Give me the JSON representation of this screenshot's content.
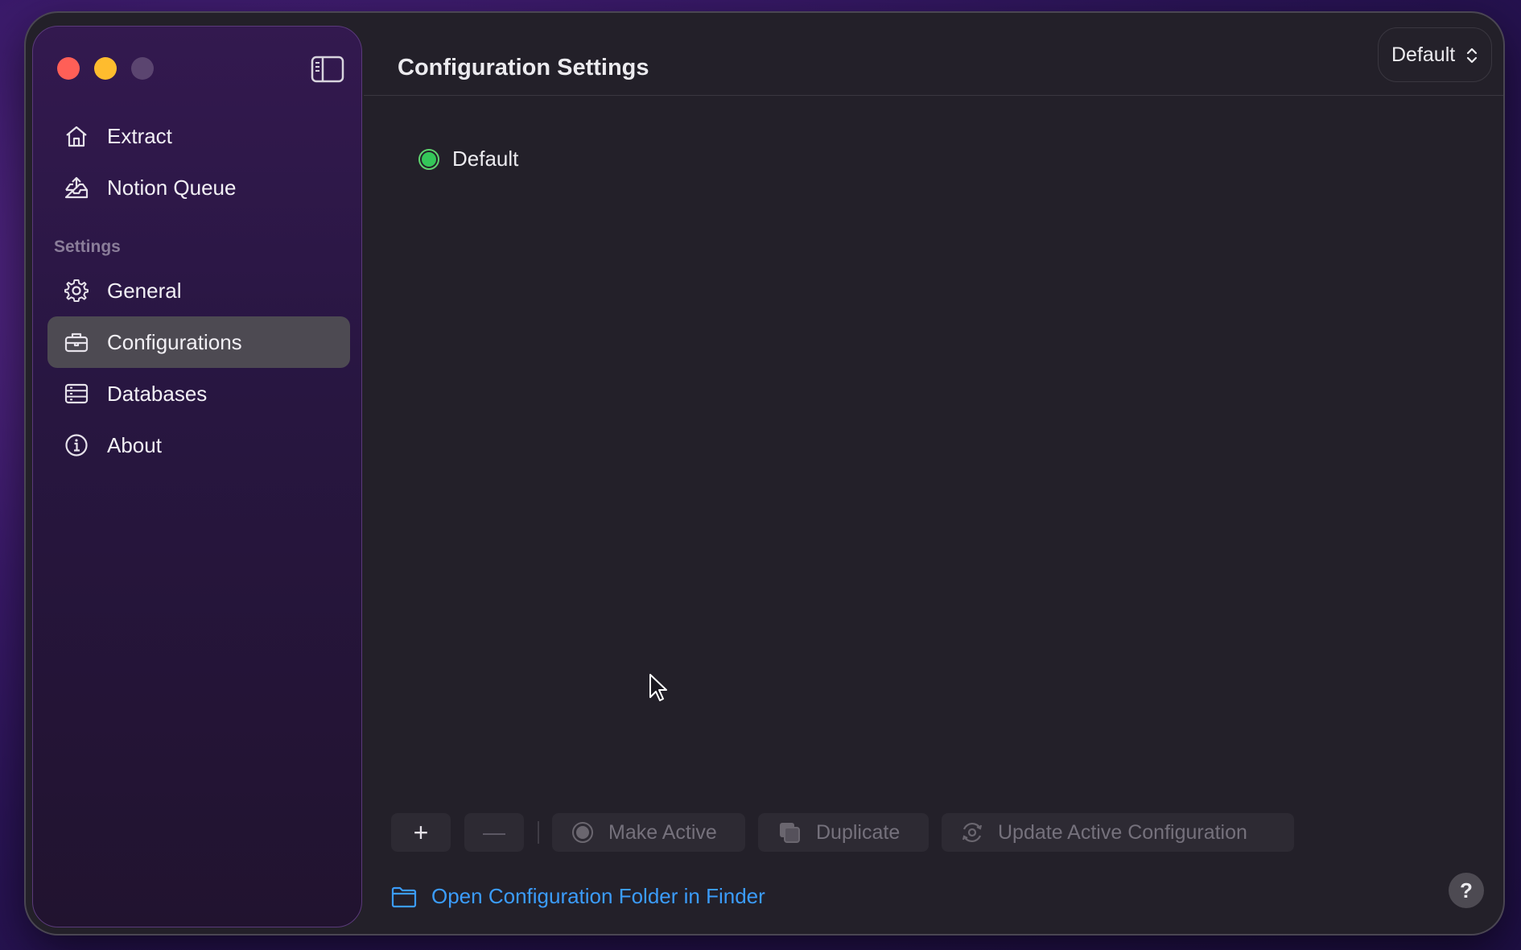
{
  "sidebar": {
    "nav_items": [
      {
        "label": "Extract",
        "icon": "house-icon"
      },
      {
        "label": "Notion Queue",
        "icon": "tray-upload-icon"
      }
    ],
    "section_label": "Settings",
    "settings_items": [
      {
        "label": "General",
        "icon": "gear-icon"
      },
      {
        "label": "Configurations",
        "icon": "briefcase-icon",
        "active": true
      },
      {
        "label": "Databases",
        "icon": "database-icon"
      },
      {
        "label": "About",
        "icon": "info-icon"
      }
    ]
  },
  "header": {
    "title": "Configuration Settings",
    "config_selector_value": "Default"
  },
  "configurations": [
    {
      "name": "Default",
      "status": "active"
    }
  ],
  "toolbar": {
    "add_label": "+",
    "remove_label": "—",
    "make_active_label": "Make Active",
    "duplicate_label": "Duplicate",
    "update_label": "Update Active Configuration"
  },
  "footer": {
    "finder_link_label": "Open Configuration Folder in Finder",
    "help_label": "?"
  },
  "colors": {
    "accent": "#3b9cfb",
    "active_status": "#34c759",
    "selected_item": "#4d4a52"
  }
}
